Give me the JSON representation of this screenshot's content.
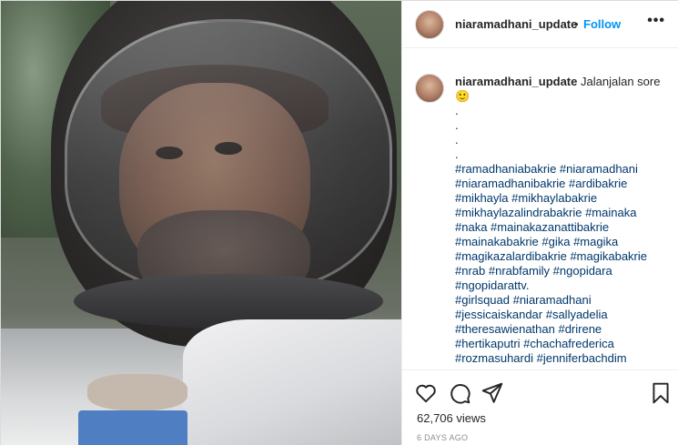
{
  "post": {
    "username": "niaramadhani_update",
    "separator": "•",
    "follow_label": "Follow",
    "more_label": "•••"
  },
  "caption": {
    "username": "niaramadhani_update",
    "text": "Jalanjalan sore",
    "emoji": "🙂",
    "dots": [
      ".",
      ".",
      ".",
      "."
    ],
    "hashtag_lines": [
      "#ramadhaniabakrie #niaramadhani",
      "#niaramadhanibakrie #ardibakrie",
      "#mikhayla #mikhaylabakrie",
      "#mikhaylazalindrabakrie #mainaka",
      "#naka #mainakazanattibakrie",
      "#mainakabakrie #gika #magika",
      "#magikazalardibakrie #magikabakrie",
      "#nrab #nrabfamily #ngopidara",
      "#ngopidarattv.",
      "#girlsquad #niaramadhani",
      "#jessicaiskandar #sallyadelia",
      "#theresawienathan #drirene",
      "#hertikaputri #chachafrederica",
      "#rozmasuhardi #jenniferbachdim"
    ]
  },
  "actions": {
    "icons": [
      "heart-icon",
      "comment-icon",
      "share-icon",
      "bookmark-icon"
    ]
  },
  "stats": {
    "views": "62,706 views",
    "time": "6 DAYS AGO"
  },
  "colors": {
    "follow": "#0095f6",
    "hashtag": "#00376b",
    "muted": "#8e8e8e"
  }
}
